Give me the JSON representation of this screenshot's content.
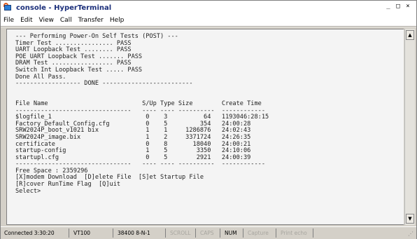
{
  "window": {
    "title": "console - HyperTerminal",
    "controls": {
      "minimize": "_",
      "maximize": "□",
      "close": "×"
    }
  },
  "menu": [
    "File",
    "Edit",
    "View",
    "Call",
    "Transfer",
    "Help"
  ],
  "terminal": {
    "lines": [
      "--- Performing Power-On Self Tests (POST) ---",
      "Timer Test ................ PASS",
      "UART Loopback Test ........ PASS",
      "POE UART Loopback Test ....... PASS",
      "DRAM Test ................. PASS",
      "Switch Int Loopback Test ..... PASS",
      "Done All Pass.",
      "------------------ DONE -------------------------",
      "",
      "",
      "File Name                          S/Up Type Size        Create Time",
      "--------------------------------   ---- ---- ----------  ------------",
      "$logfile_1                          0    3          64   1193046:28:15",
      "Factory_Default_Config.cfg          0    5         354   24:00:28",
      "SRW2024P_boot_v1021 bix             1    1     1286876   24:02:43",
      "SRW2024P_image.bix                  1    2     3371724   24:26:35",
      "certificate                         0    8       18040   24:00:21",
      "startup-config                      1    5        3350   24:10:06",
      "startupl.cfg                        0    5        2921   24:00:39",
      "--------------------------------   ---- ---- ----------  ------------",
      "Free Space : 2359296",
      "[X]modem Download  [D]elete File  [S]et Startup File",
      "[R]cover RunTime Flag  [Q]uit",
      "Select>"
    ]
  },
  "scrollbar": {
    "up_glyph": "▲",
    "down_glyph": "▼"
  },
  "status": {
    "connected": "Connected 3:30:20",
    "emulation": "VT100",
    "settings": "38400 8-N-1",
    "scroll": "SCROLL",
    "caps": "CAPS",
    "num": "NUM",
    "capture": "Capture",
    "print_echo": "Print echo"
  }
}
